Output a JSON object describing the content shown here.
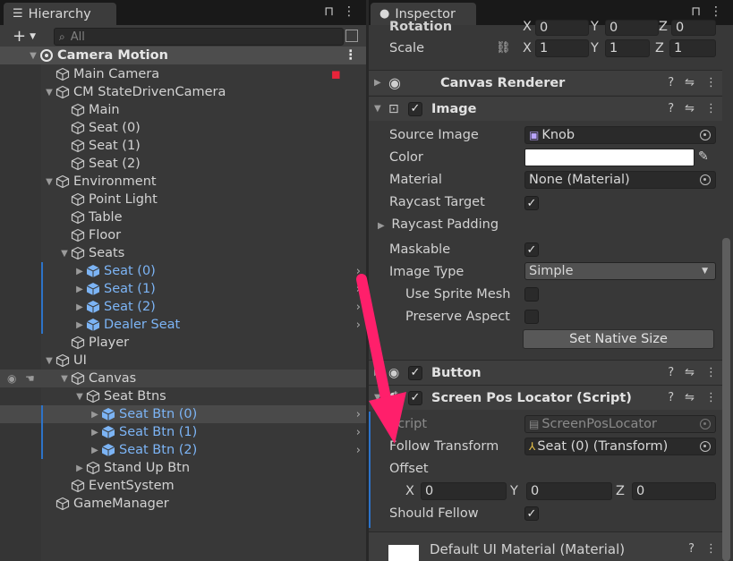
{
  "hierarchy": {
    "tab_label": "Hierarchy",
    "search_placeholder": "All",
    "rows": [
      {
        "label": "Camera Motion",
        "type": "scene"
      },
      {
        "label": "Main Camera"
      },
      {
        "label": "CM StateDrivenCamera"
      },
      {
        "label": "Main"
      },
      {
        "label": "Seat (0)"
      },
      {
        "label": "Seat (1)"
      },
      {
        "label": "Seat (2)"
      },
      {
        "label": "Environment"
      },
      {
        "label": "Point Light"
      },
      {
        "label": "Table"
      },
      {
        "label": "Floor"
      },
      {
        "label": "Seats"
      },
      {
        "label": "Seat (0)",
        "prefab": true
      },
      {
        "label": "Seat (1)",
        "prefab": true
      },
      {
        "label": "Seat (2)",
        "prefab": true
      },
      {
        "label": "Dealer Seat",
        "prefab": true
      },
      {
        "label": "Player"
      },
      {
        "label": "UI"
      },
      {
        "label": "Canvas"
      },
      {
        "label": "Seat Btns"
      },
      {
        "label": "Seat Btn (0)",
        "prefab": true,
        "selected": true
      },
      {
        "label": "Seat Btn (1)",
        "prefab": true
      },
      {
        "label": "Seat Btn (2)",
        "prefab": true
      },
      {
        "label": "Stand Up Btn"
      },
      {
        "label": "EventSystem"
      },
      {
        "label": "GameManager"
      }
    ]
  },
  "inspector": {
    "tab_label": "Inspector",
    "transform": {
      "rotation_label": "Rotation",
      "rotation": {
        "x": "0",
        "y": "0",
        "z": "0"
      },
      "scale_label": "Scale",
      "scale": {
        "x": "1",
        "y": "1",
        "z": "1"
      },
      "axis_x": "X",
      "axis_y": "Y",
      "axis_z": "Z"
    },
    "canvas_renderer": {
      "title": "Canvas Renderer"
    },
    "image": {
      "title": "Image",
      "source_image_label": "Source Image",
      "source_image_value": "Knob",
      "color_label": "Color",
      "color_value": "#ffffff",
      "material_label": "Material",
      "material_value": "None (Material)",
      "raycast_target_label": "Raycast Target",
      "raycast_target": true,
      "raycast_padding_label": "Raycast Padding",
      "maskable_label": "Maskable",
      "maskable": true,
      "image_type_label": "Image Type",
      "image_type_value": "Simple",
      "use_sprite_mesh_label": "Use Sprite Mesh",
      "use_sprite_mesh": false,
      "preserve_aspect_label": "Preserve Aspect",
      "preserve_aspect": false,
      "set_native_size_label": "Set Native Size"
    },
    "button": {
      "title": "Button"
    },
    "screen_pos_locator": {
      "title": "Screen Pos Locator (Script)",
      "script_label": "Script",
      "script_value": "ScreenPosLocator",
      "follow_transform_label": "Follow Transform",
      "follow_transform_value": "Seat (0) (Transform)",
      "offset_label": "Offset",
      "offset": {
        "x": "0",
        "y": "0",
        "z": "0"
      },
      "should_fellow_label": "Should Fellow",
      "should_fellow": true
    },
    "material": {
      "title": "Default UI Material (Material)"
    }
  },
  "colors": {
    "accent": "#2d73c8",
    "prefab_text": "#7cb4f5",
    "annotation_arrow": "#ff1f6b"
  },
  "icons": {
    "checkmark": "✓",
    "add": "+",
    "chevron_right": "›",
    "expanded": "▼",
    "collapsed": "▶"
  }
}
